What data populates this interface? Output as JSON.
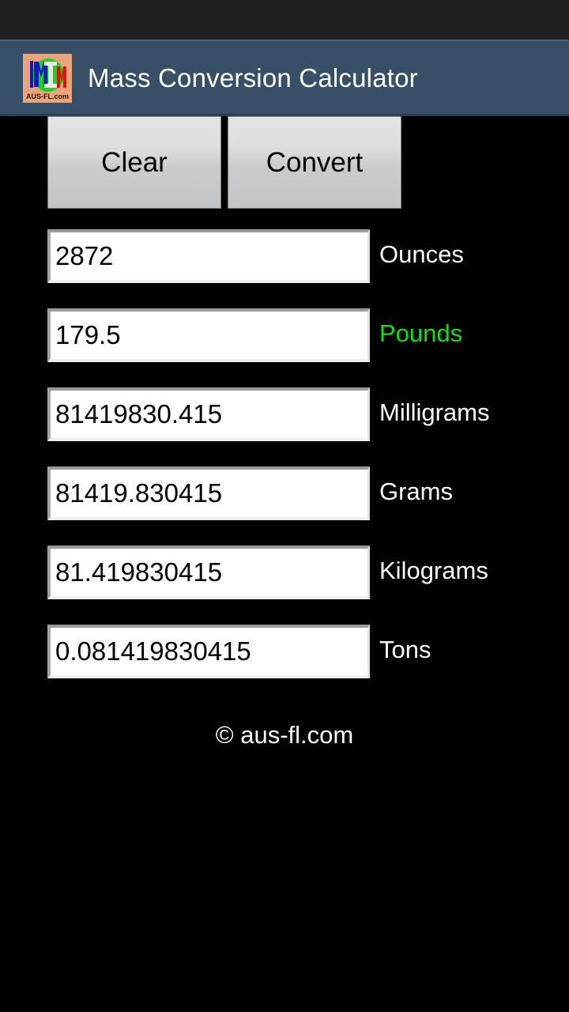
{
  "app": {
    "title": "Mass Conversion Calculator",
    "icon_name": "aus-fl-logo-icon",
    "icon_caption": "AUS-FL.com"
  },
  "colors": {
    "status_bar": "#1f2022",
    "title_bar": "#384f68",
    "background": "#000000",
    "button_face": "#dcdcdc",
    "label_default": "#ffffff",
    "label_highlight": "#11e011",
    "field_background": "#ffffff",
    "field_text": "#000000"
  },
  "toolbar": {
    "clear_label": "Clear",
    "convert_label": "Convert"
  },
  "rows": [
    {
      "value": "2872",
      "unit": "Ounces",
      "highlight": false,
      "placeholder": ""
    },
    {
      "value": "179.5",
      "unit": "Pounds",
      "highlight": true,
      "placeholder": ""
    },
    {
      "value": "81419830.415",
      "unit": "Milligrams",
      "highlight": false,
      "placeholder": ""
    },
    {
      "value": "81419.830415",
      "unit": "Grams",
      "highlight": false,
      "placeholder": ""
    },
    {
      "value": "81.419830415",
      "unit": "Kilograms",
      "highlight": false,
      "placeholder": ""
    },
    {
      "value": "0.081419830415",
      "unit": "Tons",
      "highlight": false,
      "placeholder": ""
    }
  ],
  "footer": {
    "copyright": "© aus-fl.com"
  }
}
